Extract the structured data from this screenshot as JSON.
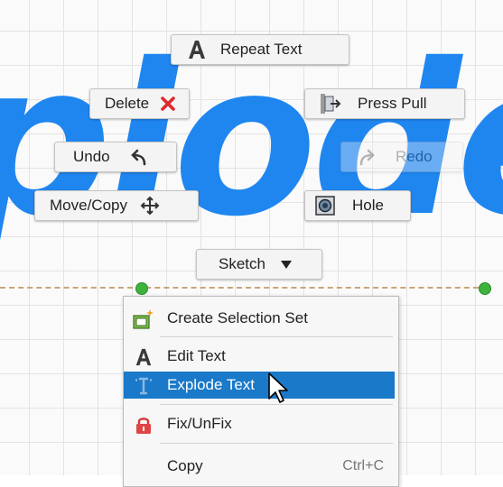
{
  "canvas": {
    "text_visible": "plode",
    "text_color": "#1f86f0"
  },
  "marking_menu": {
    "repeat_text": "Repeat Text",
    "delete": "Delete",
    "press_pull": "Press Pull",
    "undo": "Undo",
    "redo": "Redo",
    "move_copy": "Move/Copy",
    "hole": "Hole",
    "sketch": "Sketch"
  },
  "context_menu": {
    "items": [
      {
        "label": "Create Selection Set",
        "icon": "selection-set-icon"
      },
      {
        "label": "Edit Text",
        "icon": "text-a-icon"
      },
      {
        "label": "Explode Text",
        "icon": "explode-text-icon",
        "selected": true
      },
      {
        "label": "Fix/UnFix",
        "icon": "lock-icon"
      },
      {
        "label": "Copy",
        "shortcut": "Ctrl+C"
      }
    ]
  },
  "colors": {
    "accent": "#1a79c9",
    "delete": "#e0282e",
    "point": "#3db23d"
  }
}
